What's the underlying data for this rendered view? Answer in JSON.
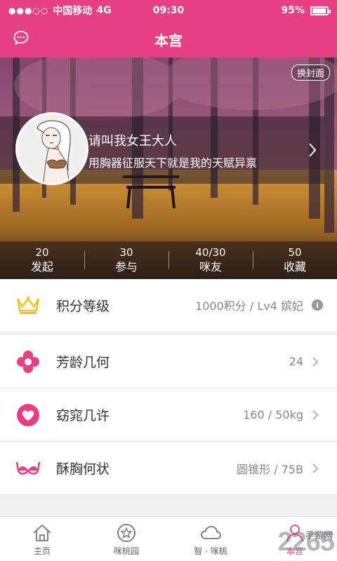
{
  "status_bar": {
    "carrier": "中国移动",
    "network": "4G",
    "time": "09:30",
    "battery": "95%",
    "battery_level": 0.95
  },
  "header": {
    "title": "本宫"
  },
  "cover": {
    "change_cover_label": "换封面"
  },
  "profile": {
    "username": "请叫我女王大人",
    "signature": "用胸器征服天下就是我的天赋异禀"
  },
  "stats": [
    {
      "value": "20",
      "label": "发起"
    },
    {
      "value": "30",
      "label": "参与"
    },
    {
      "value": "40/30",
      "label": "咪友"
    },
    {
      "value": "50",
      "label": "收藏"
    }
  ],
  "list": [
    {
      "label": "积分等级",
      "value": "1000积分 / Lv4 嫔妃",
      "icon": "crown-icon"
    },
    {
      "label": "芳龄几何",
      "value": "24",
      "icon": "flower-icon"
    },
    {
      "label": "窈窕几许",
      "value": "160 / 50kg",
      "icon": "heart-icon"
    },
    {
      "label": "酥胸何状",
      "value": "圆锥形 / 75B",
      "icon": "bra-icon"
    }
  ],
  "tabs": [
    {
      "label": "主页",
      "icon": "home-icon"
    },
    {
      "label": "咪桃园",
      "icon": "star-circle-icon"
    },
    {
      "label": "智 · 咪桃",
      "icon": "cloud-icon"
    },
    {
      "label": "本宫",
      "icon": "profile-icon"
    }
  ],
  "watermark": {
    "text": "2265",
    "sub": "手游网"
  },
  "colors": {
    "accent": "#e83e82",
    "crown": "#f2c21a"
  }
}
